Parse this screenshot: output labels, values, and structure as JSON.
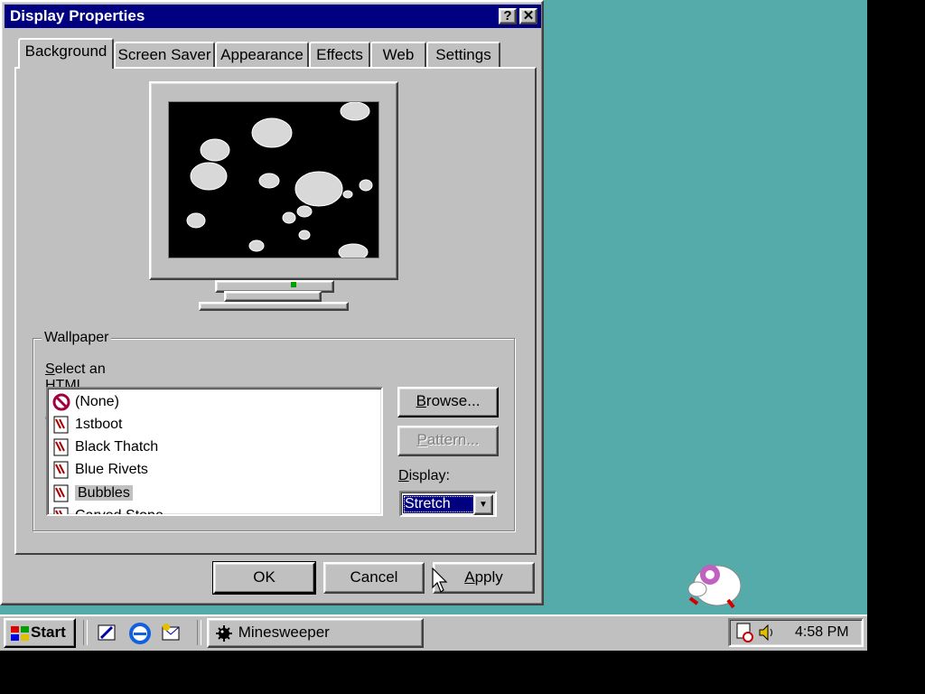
{
  "window": {
    "title": "Display Properties",
    "help_btn": "?",
    "close_btn": "✕",
    "tabs": [
      {
        "label": "Background",
        "active": true
      },
      {
        "label": "Screen Saver",
        "active": false
      },
      {
        "label": "Appearance",
        "active": false
      },
      {
        "label": "Effects",
        "active": false
      },
      {
        "label": "Web",
        "active": false
      },
      {
        "label": "Settings",
        "active": false
      }
    ]
  },
  "wallpaper": {
    "group_label": "Wallpaper",
    "select_label_ul": "S",
    "select_label_rest": "elect an HTML Document or a picture:",
    "items": [
      {
        "label": "(None)",
        "icon": "none-icon"
      },
      {
        "label": "1stboot",
        "icon": "image-file-icon"
      },
      {
        "label": "Black Thatch",
        "icon": "image-file-icon"
      },
      {
        "label": "Blue Rivets",
        "icon": "image-file-icon"
      },
      {
        "label": "Bubbles",
        "icon": "image-file-icon",
        "selected": true
      },
      {
        "label": "Carved Stone",
        "icon": "image-file-icon"
      }
    ],
    "browse_ul": "B",
    "browse_rest": "rowse...",
    "pattern_ul": "P",
    "pattern_rest": "attern...",
    "display_ul": "D",
    "display_rest": "isplay:",
    "display_value": "Stretch"
  },
  "footer": {
    "ok": "OK",
    "cancel": "Cancel",
    "apply_ul": "A",
    "apply_rest": "pply"
  },
  "taskbar": {
    "start": "Start",
    "task": "Minesweeper",
    "clock": "4:58 PM"
  },
  "colors": {
    "desktop": "#55aaaa",
    "titlebar": "#000080",
    "face": "#c0c0c0"
  }
}
